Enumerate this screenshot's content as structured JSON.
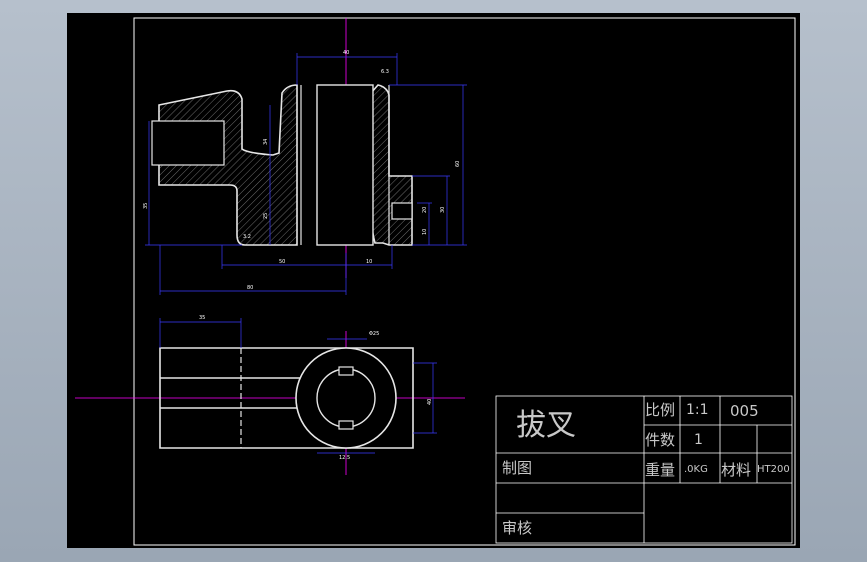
{
  "title_block": {
    "part_name": "拔叉",
    "scale_label": "比例",
    "scale_value": "1:1",
    "drawing_no": "005",
    "qty_label": "件数",
    "qty_value": "1",
    "weight_label": "重量",
    "weight_value": ".0KG",
    "material_label": "材料",
    "material_value": "HT200",
    "drawn_label": "制图",
    "review_label": "审核"
  },
  "dimensions": {
    "top_width": "40",
    "right_height": "60",
    "left_height_1": "34",
    "left_height_2": "25",
    "left_height_3": "35",
    "slot_height": "30",
    "right_step_1": "20",
    "right_step_2": "10",
    "bottom_1": "50",
    "bottom_2": "10",
    "overall_width": "80",
    "plan_width": "35",
    "bore": "Φ25",
    "plan_height": "40",
    "roughness_1": "6.3",
    "roughness_2": "3.2",
    "roughness_3": "12.5"
  },
  "colors": {
    "outline": "#e6e6e6",
    "dimension": "#3a3aff",
    "centerline": "#ff00ff",
    "frame": "#ffffff",
    "hatch": "#bfbfbf"
  }
}
